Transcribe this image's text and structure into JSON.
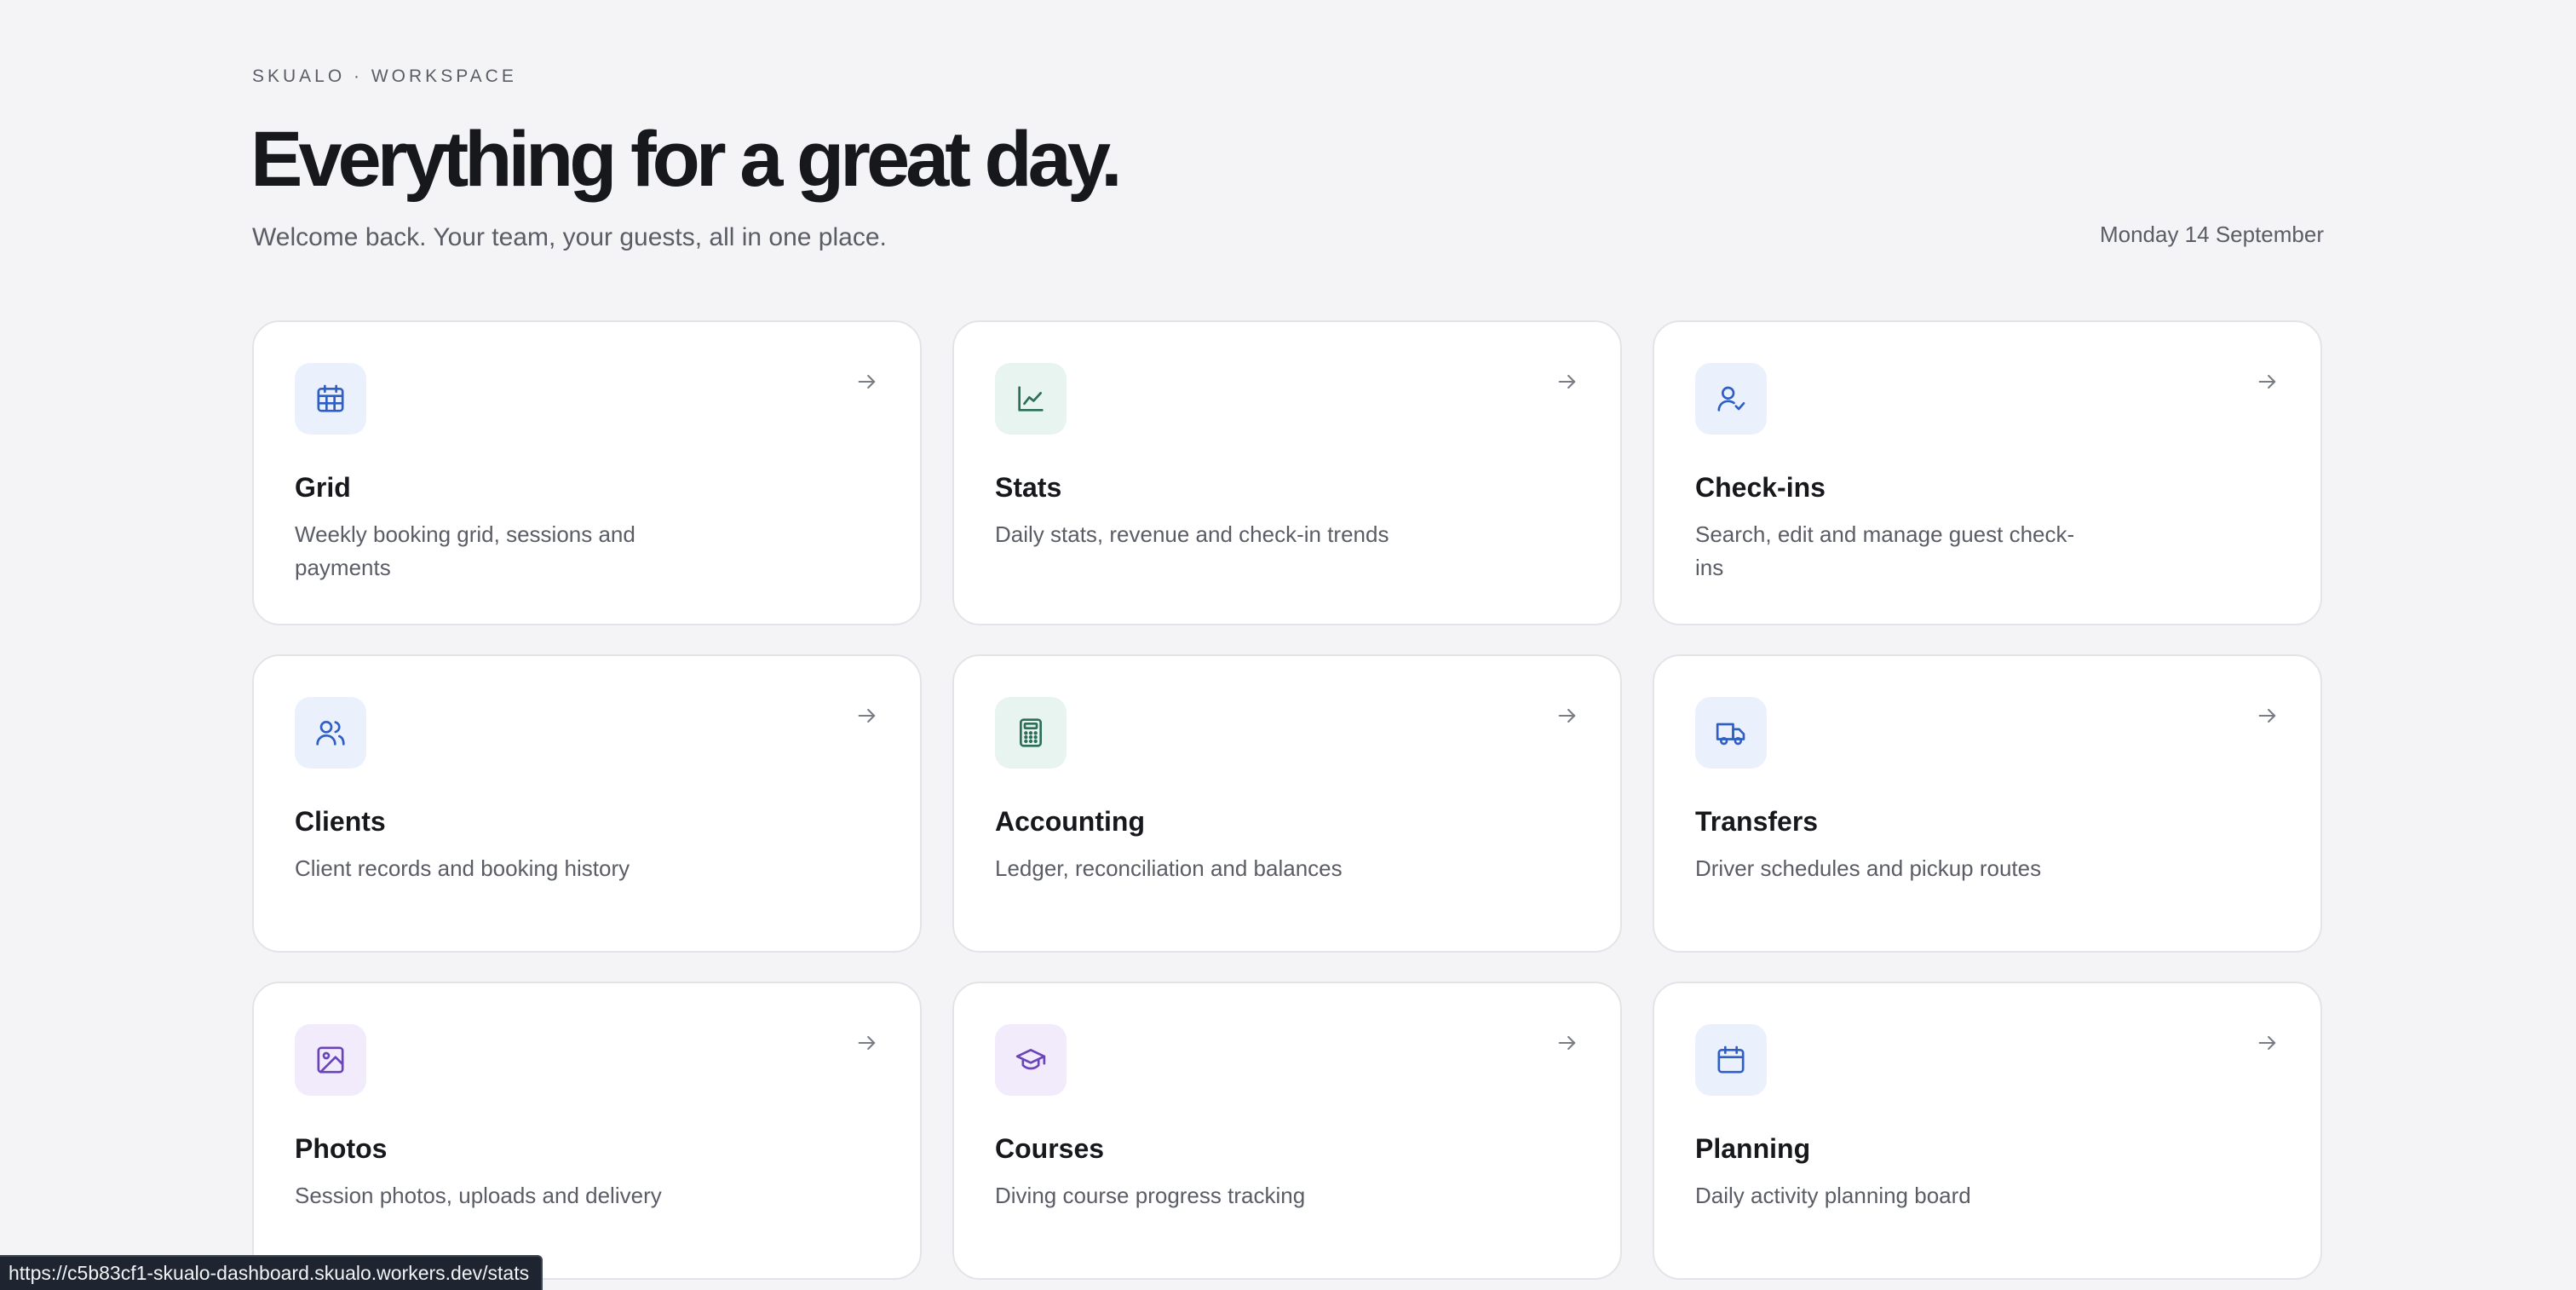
{
  "header": {
    "eyebrow": "SKUALO · WORKSPACE",
    "headline": "Everything for a great day.",
    "subtitle": "Welcome back. Your team, your guests, all in one place.",
    "date": "Monday 14 September"
  },
  "cards": [
    {
      "title": "Grid",
      "description": "Weekly booking grid, sessions and payments",
      "icon": "calendar-grid-icon",
      "tone": "blue"
    },
    {
      "title": "Stats",
      "description": "Daily stats, revenue and check-in trends",
      "icon": "line-chart-icon",
      "tone": "green"
    },
    {
      "title": "Check-ins",
      "description": "Search, edit and manage guest check-ins",
      "icon": "user-check-icon",
      "tone": "blue"
    },
    {
      "title": "Clients",
      "description": "Client records and booking history",
      "icon": "users-icon",
      "tone": "blue"
    },
    {
      "title": "Accounting",
      "description": "Ledger, reconciliation and balances",
      "icon": "calculator-icon",
      "tone": "green"
    },
    {
      "title": "Transfers",
      "description": "Driver schedules and pickup routes",
      "icon": "truck-icon",
      "tone": "blue"
    },
    {
      "title": "Photos",
      "description": "Session photos, uploads and delivery",
      "icon": "image-icon",
      "tone": "purple"
    },
    {
      "title": "Courses",
      "description": "Diving course progress tracking",
      "icon": "graduation-cap-icon",
      "tone": "purple"
    },
    {
      "title": "Planning",
      "description": "Daily activity planning board",
      "icon": "calendar-icon",
      "tone": "blue"
    }
  ],
  "status_bar": {
    "url": "https://c5b83cf1-skualo-dashboard.skualo.workers.dev/stats"
  }
}
